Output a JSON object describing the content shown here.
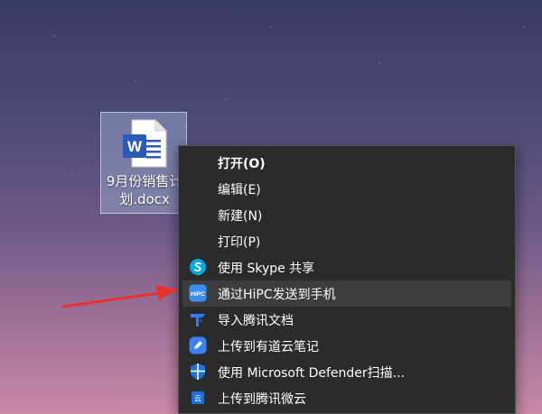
{
  "desktop": {
    "file": {
      "name": "9月份销售计\n划.docx",
      "icon": "word-document-icon",
      "icon_letter": "W"
    }
  },
  "context_menu": {
    "items": [
      {
        "label": "打开(O)",
        "bold": true,
        "icon": null
      },
      {
        "label": "编辑(E)",
        "bold": false,
        "icon": null
      },
      {
        "label": "新建(N)",
        "bold": false,
        "icon": null
      },
      {
        "label": "打印(P)",
        "bold": false,
        "icon": null
      },
      {
        "label": "使用 Skype 共享",
        "bold": false,
        "icon": "skype-icon"
      },
      {
        "label": "通过HiPC发送到手机",
        "bold": false,
        "icon": "hipc-icon",
        "highlighted": true,
        "icon_text": "HiPC"
      },
      {
        "label": "导入腾讯文档",
        "bold": false,
        "icon": "tencent-docs-icon"
      },
      {
        "label": "上传到有道云笔记",
        "bold": false,
        "icon": "youdao-note-icon"
      },
      {
        "label": "使用 Microsoft Defender扫描...",
        "bold": false,
        "icon": "defender-shield-icon"
      },
      {
        "label": "上传到腾讯微云",
        "bold": false,
        "icon": "weiyun-icon",
        "icon_text": "云"
      }
    ]
  },
  "colors": {
    "menu_bg": "#2b2b2b",
    "highlight": "#3d3d3d",
    "arrow": "#e8322f",
    "word_blue": "#2b5bb8"
  }
}
